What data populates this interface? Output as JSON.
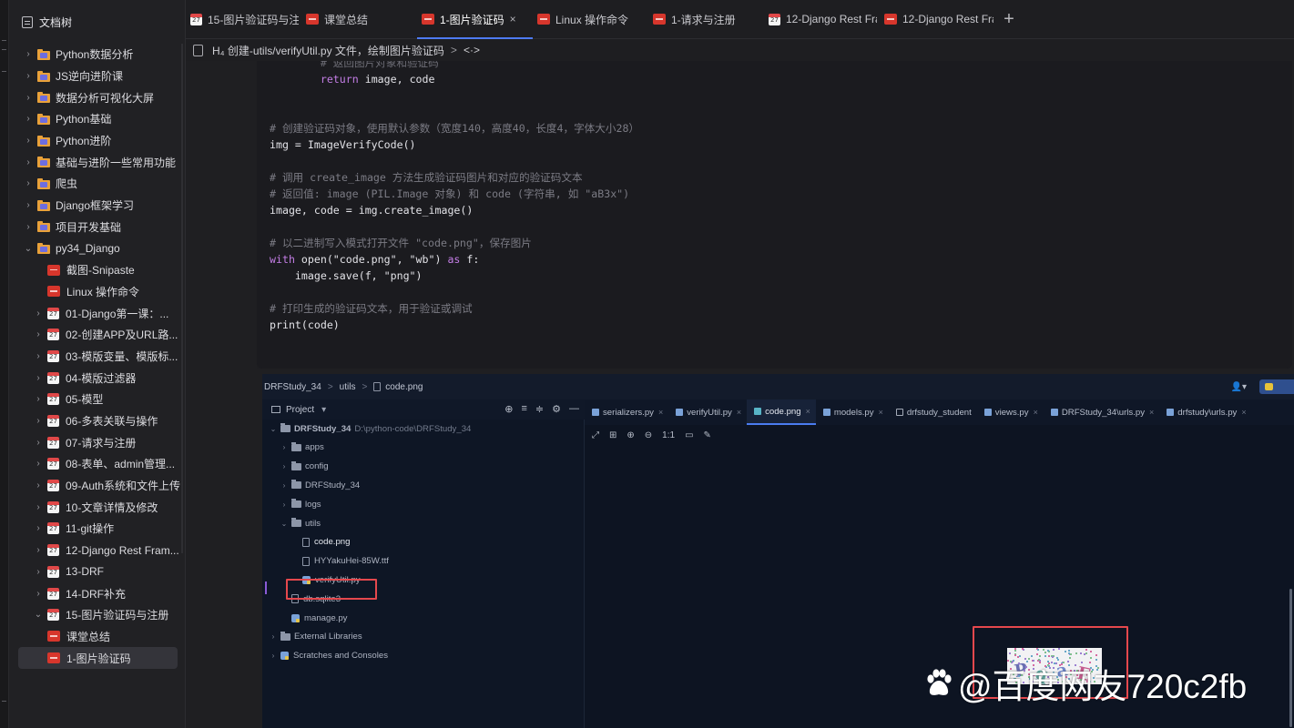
{
  "sidebar": {
    "title": "文档树",
    "items": [
      {
        "label": "Python数据分析",
        "level": 0,
        "icon": "folder",
        "expanded": false
      },
      {
        "label": "JS逆向进阶课",
        "level": 0,
        "icon": "folder",
        "expanded": false
      },
      {
        "label": "数据分析可视化大屏",
        "level": 0,
        "icon": "folder",
        "expanded": false
      },
      {
        "label": "Python基础",
        "level": 0,
        "icon": "folder",
        "expanded": false
      },
      {
        "label": "Python进阶",
        "level": 0,
        "icon": "folder",
        "expanded": false
      },
      {
        "label": "基础与进阶一些常用功能",
        "level": 0,
        "icon": "folder",
        "expanded": false
      },
      {
        "label": "爬虫",
        "level": 0,
        "icon": "folder",
        "expanded": false
      },
      {
        "label": "Django框架学习",
        "level": 0,
        "icon": "folder",
        "expanded": false
      },
      {
        "label": "项目开发基础",
        "level": 0,
        "icon": "folder",
        "expanded": false
      },
      {
        "label": "py34_Django",
        "level": 0,
        "icon": "folder",
        "expanded": true
      },
      {
        "label": "截图-Snipaste",
        "level": 1,
        "icon": "red-doc"
      },
      {
        "label": "Linux 操作命令",
        "level": 1,
        "icon": "red-doc"
      },
      {
        "label": "01-Django第一课：...",
        "level": 1,
        "icon": "calendar",
        "expanded": false
      },
      {
        "label": "02-创建APP及URL路...",
        "level": 1,
        "icon": "calendar",
        "expanded": false
      },
      {
        "label": "03-模版变量、模版标...",
        "level": 1,
        "icon": "calendar",
        "expanded": false
      },
      {
        "label": "04-模版过滤器",
        "level": 1,
        "icon": "calendar",
        "expanded": false
      },
      {
        "label": "05-模型",
        "level": 1,
        "icon": "calendar",
        "expanded": false
      },
      {
        "label": "06-多表关联与操作",
        "level": 1,
        "icon": "calendar",
        "expanded": false
      },
      {
        "label": "07-请求与注册",
        "level": 1,
        "icon": "calendar",
        "expanded": false
      },
      {
        "label": "08-表单、admin管理...",
        "level": 1,
        "icon": "calendar",
        "expanded": false
      },
      {
        "label": "09-Auth系统和文件上传",
        "level": 1,
        "icon": "calendar",
        "expanded": false
      },
      {
        "label": "10-文章详情及修改",
        "level": 1,
        "icon": "calendar",
        "expanded": false
      },
      {
        "label": "11-git操作",
        "level": 1,
        "icon": "calendar",
        "expanded": false
      },
      {
        "label": "12-Django Rest Fram...",
        "level": 1,
        "icon": "calendar",
        "expanded": false
      },
      {
        "label": "13-DRF",
        "level": 1,
        "icon": "calendar",
        "expanded": false
      },
      {
        "label": "14-DRF补充",
        "level": 1,
        "icon": "calendar",
        "expanded": false
      },
      {
        "label": "15-图片验证码与注册",
        "level": 1,
        "icon": "calendar",
        "expanded": true
      },
      {
        "label": "课堂总结",
        "level": 2,
        "icon": "red-doc"
      },
      {
        "label": "1-图片验证码",
        "level": 2,
        "icon": "red-doc",
        "active": true
      }
    ]
  },
  "tabs": [
    {
      "label": "15-图片验证码与注",
      "icon": "calendar"
    },
    {
      "label": "课堂总结",
      "icon": "red-doc"
    },
    {
      "label": "1-图片验证码",
      "icon": "red-doc",
      "active": true,
      "close": "×"
    },
    {
      "label": "Linux 操作命令",
      "icon": "red-doc"
    },
    {
      "label": "1-请求与注册",
      "icon": "red-doc"
    },
    {
      "label": "12-Django Rest Fra",
      "icon": "calendar"
    },
    {
      "label": "12-Django Rest Fra",
      "icon": "red-doc"
    }
  ],
  "add_tab": "+",
  "breadcrumb": {
    "heading": "H₄ 创建-utils/verifyUtil.py 文件，绘制图片验证码",
    "sep": ">",
    "code_icon": "<·>"
  },
  "code": {
    "lines": [
      {
        "parts": [
          {
            "t": "        # 返回图片对象和验证码",
            "c": "fade"
          }
        ]
      },
      {
        "parts": [
          {
            "t": "        ",
            "c": ""
          },
          {
            "t": "return",
            "c": "kw"
          },
          {
            "t": " image, code",
            "c": ""
          }
        ]
      },
      {
        "parts": []
      },
      {
        "parts": []
      },
      {
        "parts": [
          {
            "t": "# 创建验证码对象，使用默认参数（宽度140，高度40，长度4，字体大小28）",
            "c": "cm"
          }
        ]
      },
      {
        "parts": [
          {
            "t": "img = ImageVerifyCode()",
            "c": ""
          }
        ]
      },
      {
        "parts": []
      },
      {
        "parts": [
          {
            "t": "# 调用 create_image 方法生成验证码图片和对应的验证码文本",
            "c": "cm"
          }
        ]
      },
      {
        "parts": [
          {
            "t": "# 返回值: image (PIL.Image 对象) 和 code (字符串, 如 \"aB3x\")",
            "c": "cm"
          }
        ]
      },
      {
        "parts": [
          {
            "t": "image, code = img.create_image()",
            "c": ""
          }
        ]
      },
      {
        "parts": []
      },
      {
        "parts": [
          {
            "t": "# 以二进制写入模式打开文件 \"code.png\"，保存图片",
            "c": "cm"
          }
        ]
      },
      {
        "parts": [
          {
            "t": "with",
            "c": "kw"
          },
          {
            "t": " open(\"code.png\", \"wb\") ",
            "c": ""
          },
          {
            "t": "as",
            "c": "kw"
          },
          {
            "t": " f:",
            "c": ""
          }
        ]
      },
      {
        "parts": [
          {
            "t": "    image.save(f, \"png\")",
            "c": ""
          }
        ]
      },
      {
        "parts": []
      },
      {
        "parts": [
          {
            "t": "# 打印生成的验证码文本，用于验证或调试",
            "c": "cm"
          }
        ]
      },
      {
        "parts": [
          {
            "t": "print(code)",
            "c": ""
          }
        ]
      }
    ]
  },
  "ide": {
    "nav": {
      "project": "DRFStudy_34",
      "folder": "utils",
      "file": "code.png",
      "sep": ">"
    },
    "project_panel": {
      "title": "Project",
      "dropdown": "▾",
      "tools": [
        "⊕",
        "≡",
        "≑",
        "⚙",
        "—"
      ],
      "rows": [
        {
          "label": "DRFStudy_34",
          "path": "D:\\python-code\\DRFStudy_34",
          "depth": 0,
          "chev": "v",
          "icon": "folder",
          "bold": true
        },
        {
          "label": "apps",
          "depth": 1,
          "chev": ">",
          "icon": "folder"
        },
        {
          "label": "config",
          "depth": 1,
          "chev": ">",
          "icon": "folder"
        },
        {
          "label": "DRFStudy_34",
          "depth": 1,
          "chev": ">",
          "icon": "folder"
        },
        {
          "label": "logs",
          "depth": 1,
          "chev": ">",
          "icon": "folder"
        },
        {
          "label": "utils",
          "depth": 1,
          "chev": "v",
          "icon": "folder"
        },
        {
          "label": "code.png",
          "depth": 2,
          "chev": "",
          "icon": "file",
          "selected": true
        },
        {
          "label": "HYYakuHei-85W.ttf",
          "depth": 2,
          "chev": "",
          "icon": "file"
        },
        {
          "label": "verifyUtil.py",
          "depth": 2,
          "chev": "",
          "icon": "py"
        },
        {
          "label": "db.sqlite3",
          "depth": 1,
          "chev": "",
          "icon": "file"
        },
        {
          "label": "manage.py",
          "depth": 1,
          "chev": "",
          "icon": "py"
        },
        {
          "label": "External Libraries",
          "depth": 0,
          "chev": ">",
          "icon": "lib"
        },
        {
          "label": "Scratches and Consoles",
          "depth": 0,
          "chev": ">",
          "icon": "scratch"
        }
      ]
    },
    "editor_tabs": [
      {
        "label": "serializers.py",
        "icon": "py"
      },
      {
        "label": "verifyUtil.py",
        "icon": "py"
      },
      {
        "label": "code.png",
        "icon": "img",
        "active": true
      },
      {
        "label": "models.py",
        "icon": "py"
      },
      {
        "label": "drfstudy_student",
        "icon": "tbl",
        "noclose": true
      },
      {
        "label": "views.py",
        "icon": "py"
      },
      {
        "label": "DRFStudy_34\\urls.py",
        "icon": "py"
      },
      {
        "label": "drfstudy\\urls.py",
        "icon": "py"
      }
    ],
    "tab_close": "×",
    "image_tools": [
      "⤢",
      "⊞",
      "⊕",
      "⊖",
      "1:1",
      "▭",
      "✎"
    ],
    "user_icon": "👤▾"
  },
  "captcha_visible_text": "PqaE",
  "watermark": "@百度网友720c2fb",
  "colors": {
    "accent": "#4e7bf6",
    "highlight_box": "#e5484d",
    "keyword": "#c47ee6"
  }
}
